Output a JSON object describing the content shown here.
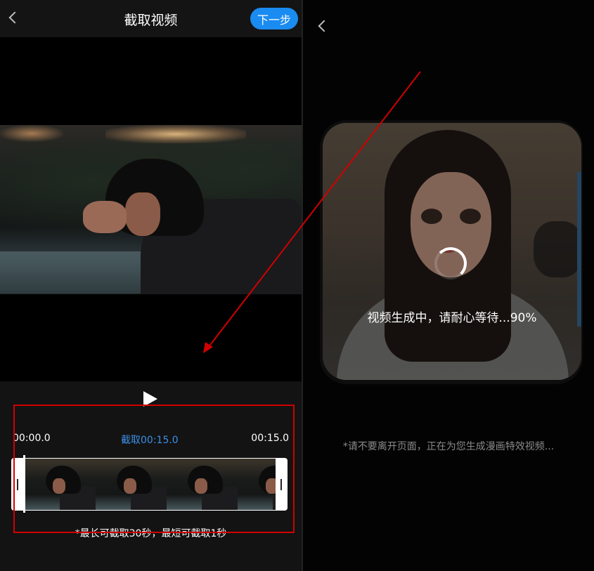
{
  "left_panel": {
    "header": {
      "title": "截取视频",
      "next_label": "下一步"
    },
    "timeline": {
      "start_time": "00:00.0",
      "clip_label": "截取00:15.0",
      "end_time": "00:15.0"
    },
    "hint": "*最长可截取30秒，最短可截取1秒"
  },
  "right_panel": {
    "status": "视频生成中，请耐心等待...90%",
    "progress_percent": 90,
    "hint": "*请不要离开页面，正在为您生成漫画特效视频..."
  },
  "icons": {
    "back": "chevron-left-icon",
    "play": "play-icon",
    "loading": "spinner-icon"
  },
  "colors": {
    "accent_blue": "#1a8bf0",
    "clip_label_blue": "#3b8fe6",
    "annotation_red": "#d10000"
  }
}
